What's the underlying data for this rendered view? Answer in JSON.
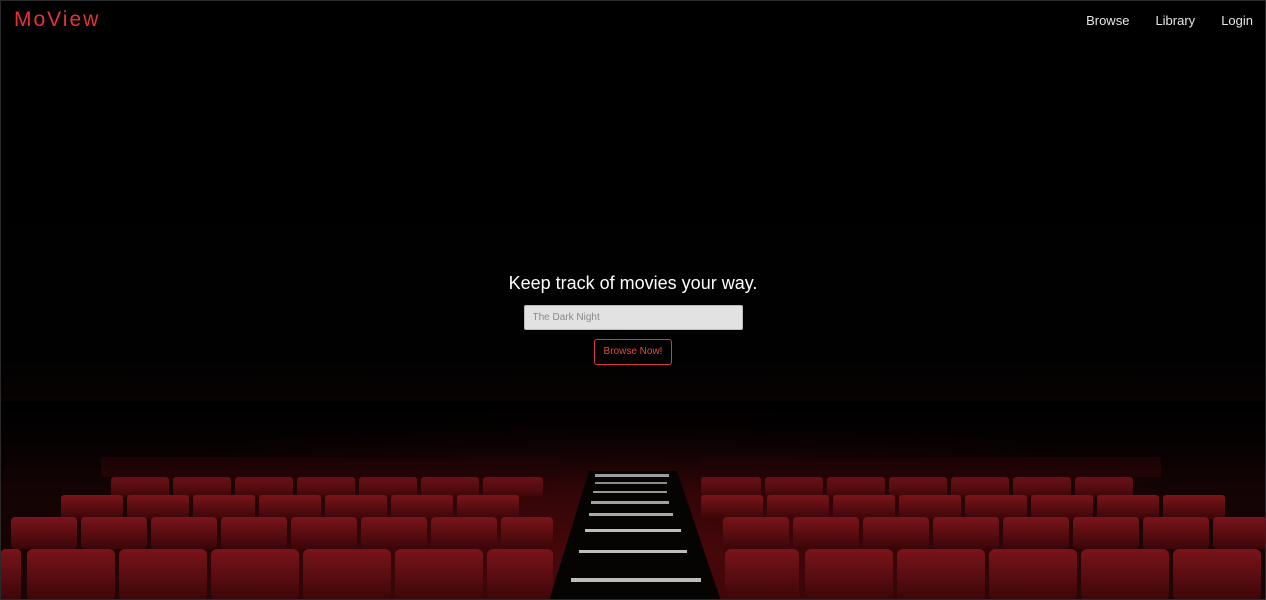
{
  "brand": {
    "logo_text": "MoView",
    "accent_color": "#e5313a"
  },
  "nav": {
    "items": [
      {
        "label": "Browse"
      },
      {
        "label": "Library"
      },
      {
        "label": "Login"
      }
    ]
  },
  "hero": {
    "title": "Keep track of movies your way.",
    "search": {
      "placeholder": "The Dark Night",
      "value": ""
    },
    "cta_label": "Browse Now!"
  },
  "background": {
    "image": "dark-movie-theater-red-seats"
  }
}
